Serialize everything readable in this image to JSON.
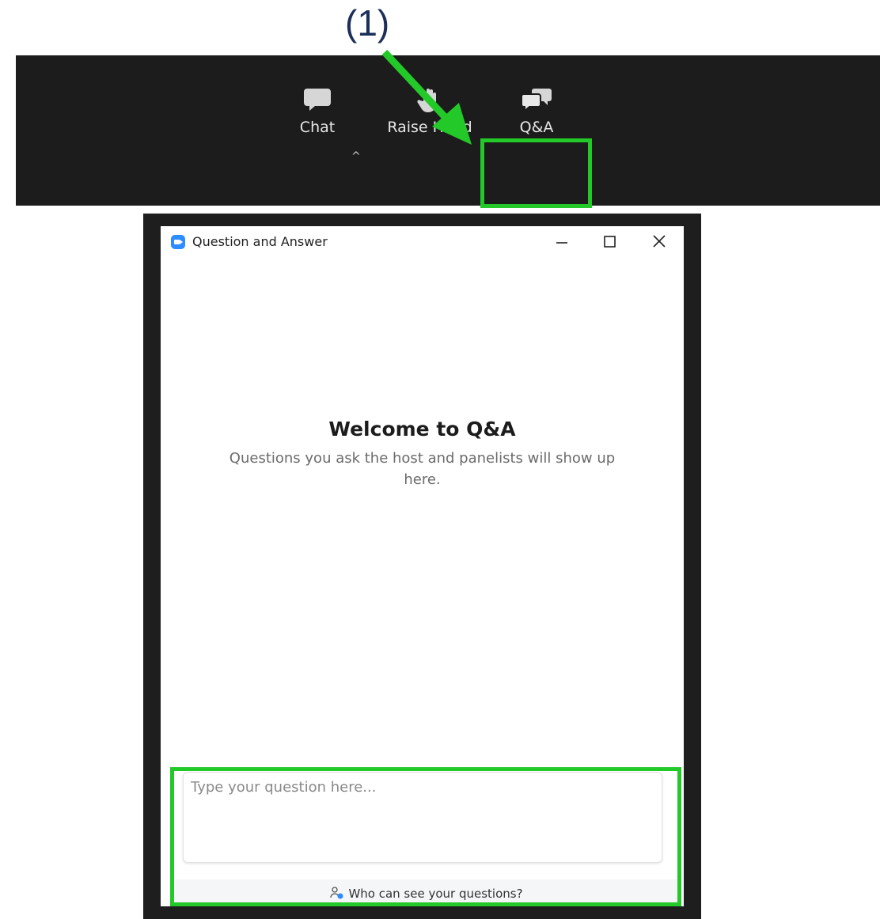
{
  "annotation": {
    "step_label": "(1)"
  },
  "toolbar": {
    "chat_label": "Chat",
    "chat_caret": "^",
    "raise_hand_label": "Raise Hand",
    "qa_label": "Q&A"
  },
  "qa_window": {
    "title": "Question and Answer",
    "welcome_title": "Welcome to Q&A",
    "welcome_subtitle": "Questions you ask the host and panelists will show up here.",
    "input_placeholder": "Type your question here...",
    "footer_link": "Who can see your questions?"
  },
  "colors": {
    "highlight": "#22c928",
    "toolbar_bg": "#1c1c1c",
    "annotation_text": "#1b2f5a",
    "zoom_blue": "#2d8cff"
  },
  "icons": [
    "chat-bubble-icon",
    "caret-up-icon",
    "raise-hand-icon",
    "qa-bubbles-icon",
    "zoom-logo-icon",
    "minimize-icon",
    "maximize-icon",
    "close-icon",
    "people-icon"
  ]
}
